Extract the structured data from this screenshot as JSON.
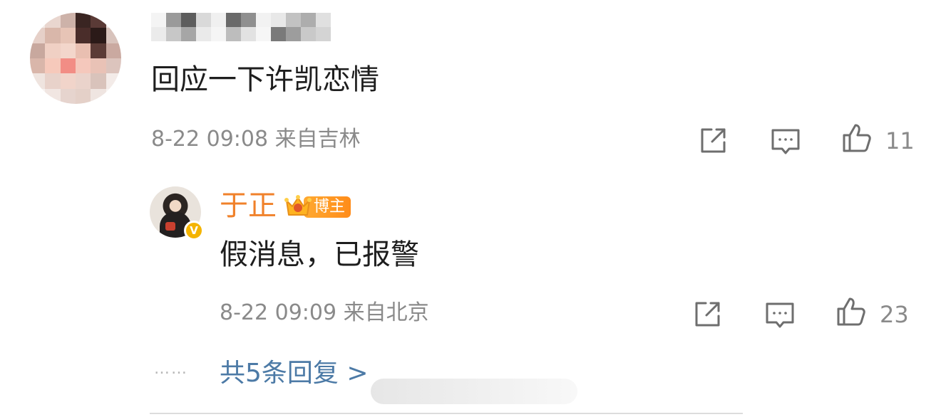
{
  "comment": {
    "text": "回应一下许凯恋情",
    "meta": "8-22 09:08 来自吉林",
    "like_count": "11"
  },
  "reply": {
    "author": "于正",
    "badge_label": "博主",
    "text": "假消息，已报警",
    "meta": "8-22 09:09 来自北京",
    "like_count": "23"
  },
  "more_replies": {
    "dots": "……",
    "label": "共5条回复 >"
  },
  "colors": {
    "reply_name": "#f0812a",
    "link": "#4c7aa6",
    "meta": "#8a8a8a"
  }
}
